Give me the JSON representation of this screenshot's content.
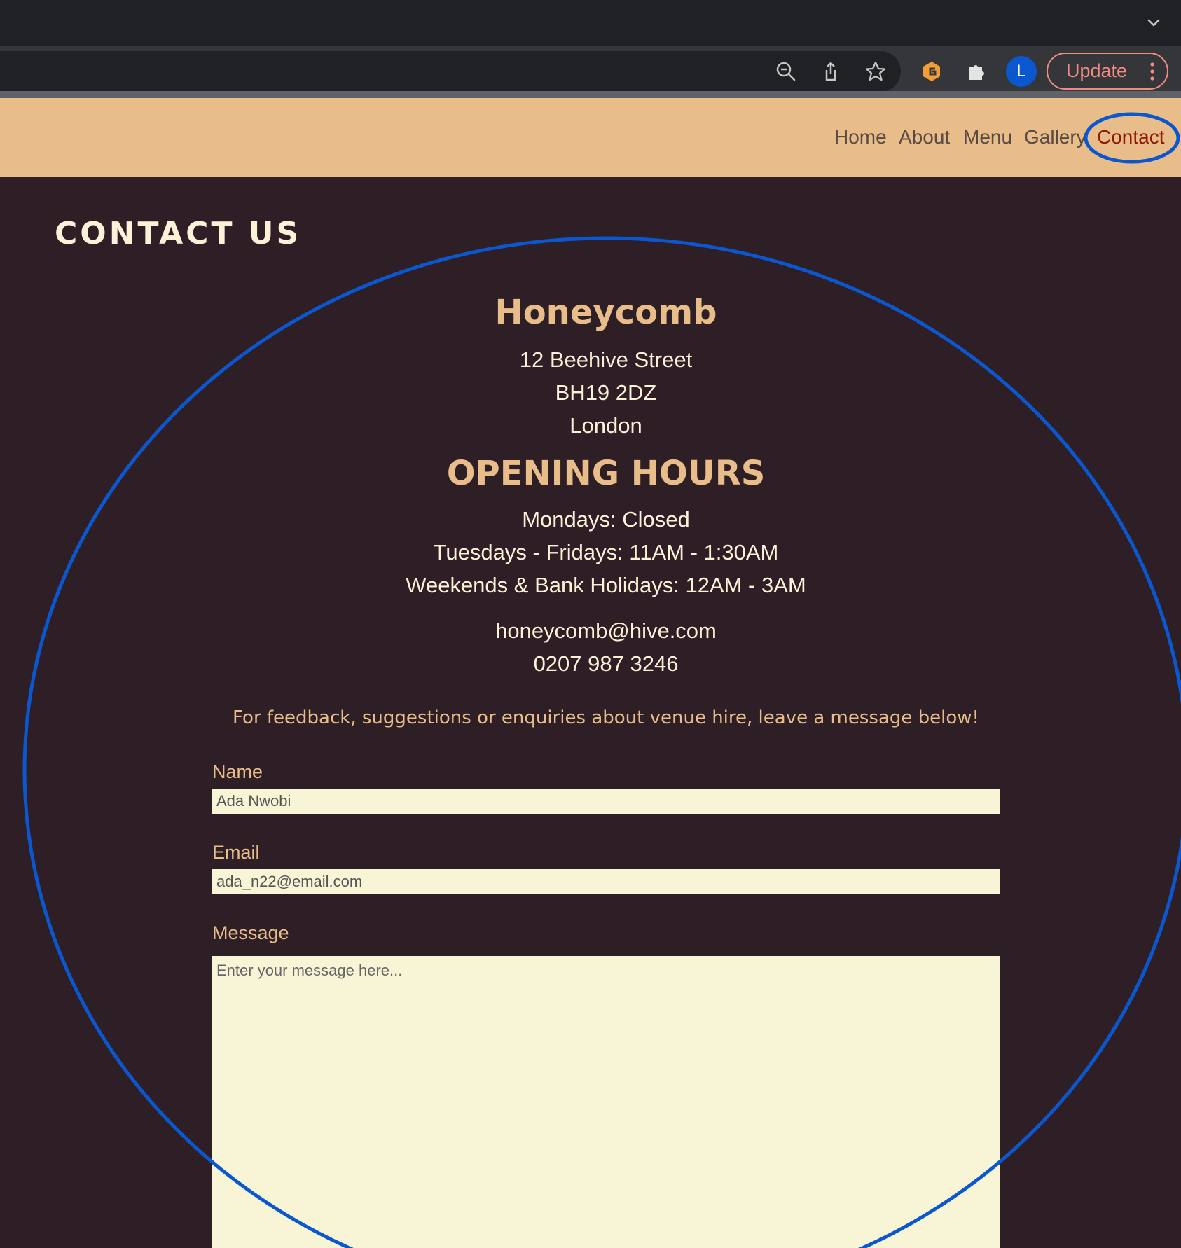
{
  "browser": {
    "update_label": "Update",
    "avatar_letter": "L"
  },
  "nav": {
    "items": [
      {
        "label": "Home"
      },
      {
        "label": "About"
      },
      {
        "label": "Menu"
      },
      {
        "label": "Gallery"
      },
      {
        "label": "Contact"
      }
    ],
    "active_item": "Contact"
  },
  "page": {
    "title": "CONTACT US"
  },
  "business": {
    "name": "Honeycomb",
    "address": [
      "12 Beehive Street",
      "BH19 2DZ",
      "London"
    ]
  },
  "hours": {
    "title": "OPENING HOURS",
    "lines": [
      "Mondays: Closed",
      "Tuesdays - Fridays: 11AM - 1:30AM",
      "Weekends & Bank Holidays: 12AM - 3AM"
    ]
  },
  "contact": {
    "email": "honeycomb@hive.com",
    "phone": "0207 987 3246"
  },
  "form": {
    "intro": "For feedback, suggestions or enquiries about venue hire, leave a message below!",
    "name_label": "Name",
    "name_value": "Ada Nwobi",
    "email_label": "Email",
    "email_value": "ada_n22@email.com",
    "message_label": "Message",
    "message_placeholder": "Enter your message here..."
  },
  "colors": {
    "nav_background": "#e8bd89",
    "page_background": "#2e1f27",
    "accent": "#e8bd89",
    "input_background": "#f8f4d6",
    "annotation": "#0b57d0"
  }
}
